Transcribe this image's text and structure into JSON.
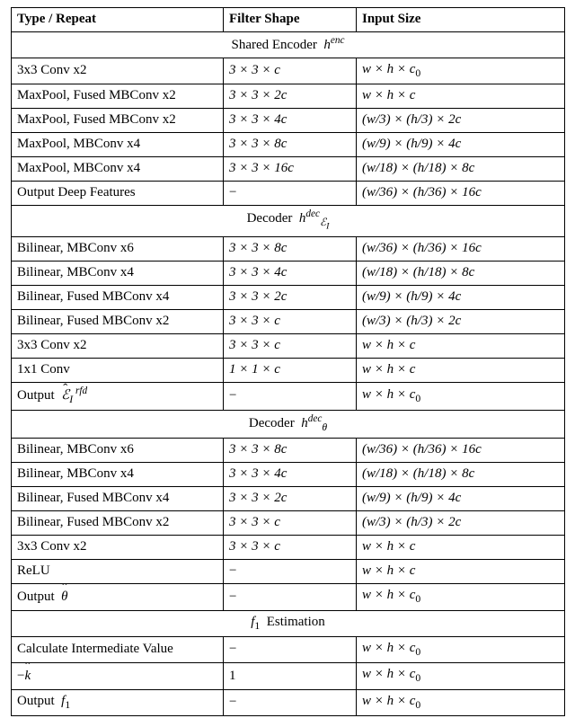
{
  "header": {
    "c1": "Type / Repeat",
    "c2": "Filter Shape",
    "c3": "Input Size"
  },
  "enc": {
    "title_pre": "Shared Encoder  ",
    "sym_h": "h",
    "sym_sup": "enc",
    "rows": [
      {
        "t": "3x3 Conv x2",
        "f": "3 × 3 × c",
        "i_pre": "w × h × c",
        "i_sub": "0"
      },
      {
        "t": "MaxPool, Fused MBConv x2",
        "f": "3 × 3 × 2c",
        "i_pre": "w × h × c",
        "i_sub": ""
      },
      {
        "t": "MaxPool, Fused MBConv x2",
        "f": "3 × 3 × 4c",
        "i_pre": "(w/3) × (h/3) × 2c",
        "i_sub": ""
      },
      {
        "t": "MaxPool, MBConv x4",
        "f": "3 × 3 × 8c",
        "i_pre": "(w/9) × (h/9) × 4c",
        "i_sub": ""
      },
      {
        "t": "MaxPool, MBConv x4",
        "f": "3 × 3 × 16c",
        "i_pre": "(w/18) × (h/18) × 8c",
        "i_sub": ""
      },
      {
        "t": "Output Deep Features",
        "f": "−",
        "i_pre": "(w/36) × (h/36) × 16c",
        "i_sub": ""
      }
    ]
  },
  "decE": {
    "title_pre": "Decoder  ",
    "sym_h": "h",
    "sym_sup": "dec",
    "sym_sub": "ℰ",
    "sym_subsub": "I",
    "rows": [
      {
        "t": "Bilinear, MBConv x6",
        "f": "3 × 3 × 8c",
        "i_pre": "(w/36) × (h/36) × 16c",
        "i_sub": ""
      },
      {
        "t": "Bilinear, MBConv x4",
        "f": "3 × 3 × 4c",
        "i_pre": "(w/18) × (h/18) × 8c",
        "i_sub": ""
      },
      {
        "t": "Bilinear, Fused MBConv x4",
        "f": "3 × 3 × 2c",
        "i_pre": "(w/9) × (h/9) × 4c",
        "i_sub": ""
      },
      {
        "t": "Bilinear, Fused MBConv x2",
        "f": "3 × 3 × c",
        "i_pre": "(w/3) × (h/3) × 2c",
        "i_sub": ""
      },
      {
        "t": "3x3 Conv x2",
        "f": "3 × 3 × c",
        "i_pre": "w × h × c",
        "i_sub": ""
      },
      {
        "t": "1x1 Conv",
        "f": "1 × 1 × c",
        "i_pre": "w × h × c",
        "i_sub": ""
      }
    ],
    "out": {
      "t_pre": "Output  ",
      "sym_E": "ℰ",
      "sym_Esub": "I",
      "sym_Esup": "rfd",
      "f": "−",
      "i_pre": "w × h × c",
      "i_sub": "0"
    }
  },
  "decT": {
    "title_pre": "Decoder  ",
    "sym_h": "h",
    "sym_sup": "dec",
    "sym_sub": "θ",
    "rows": [
      {
        "t": "Bilinear, MBConv x6",
        "f": "3 × 3 × 8c",
        "i_pre": "(w/36) × (h/36) × 16c",
        "i_sub": ""
      },
      {
        "t": "Bilinear, MBConv x4",
        "f": "3 × 3 × 4c",
        "i_pre": "(w/18) × (h/18) × 8c",
        "i_sub": ""
      },
      {
        "t": "Bilinear, Fused MBConv x4",
        "f": "3 × 3 × 2c",
        "i_pre": "(w/9) × (h/9) × 4c",
        "i_sub": ""
      },
      {
        "t": "Bilinear, Fused MBConv x2",
        "f": "3 × 3 × c",
        "i_pre": "(w/3) × (h/3) × 2c",
        "i_sub": ""
      },
      {
        "t": "3x3 Conv x2",
        "f": "3 × 3 × c",
        "i_pre": "w × h × c",
        "i_sub": ""
      },
      {
        "t": "ReLU",
        "f": "−",
        "i_pre": "w × h × c",
        "i_sub": ""
      }
    ],
    "out": {
      "t_pre": "Output  ",
      "sym_theta": "θ",
      "f": "−",
      "i_pre": "w × h × c",
      "i_sub": "0"
    }
  },
  "f1": {
    "title_f": "f",
    "title_sub": "1",
    "title_post": "  Estimation",
    "rows": [
      {
        "t": "Calculate Intermediate Value",
        "f": "−",
        "i_pre": "w × h × c",
        "i_sub": "0"
      }
    ],
    "neg": {
      "t_pre": "−",
      "sym_k": "k",
      "f": "1",
      "i_pre": "w × h × c",
      "i_sub": "0"
    },
    "out": {
      "t_pre": "Output  ",
      "sym_f": "f",
      "sym_sub": "1",
      "f": "−",
      "i_pre": "w × h × c",
      "i_sub": "0"
    }
  },
  "chart_data": {
    "type": "table",
    "title": "Network architecture",
    "columns": [
      "Type / Repeat",
      "Filter Shape",
      "Input Size"
    ],
    "sections": [
      {
        "heading": "Shared Encoder h^{enc}",
        "rows": [
          [
            "3x3 Conv x2",
            "3×3×c",
            "w×h×c_0"
          ],
          [
            "MaxPool, Fused MBConv x2",
            "3×3×2c",
            "w×h×c"
          ],
          [
            "MaxPool, Fused MBConv x2",
            "3×3×4c",
            "(w/3)×(h/3)×2c"
          ],
          [
            "MaxPool, MBConv x4",
            "3×3×8c",
            "(w/9)×(h/9)×4c"
          ],
          [
            "MaxPool, MBConv x4",
            "3×3×16c",
            "(w/18)×(h/18)×8c"
          ],
          [
            "Output Deep Features",
            "−",
            "(w/36)×(h/36)×16c"
          ]
        ]
      },
      {
        "heading": "Decoder h^{dec}_{E_I}",
        "rows": [
          [
            "Bilinear, MBConv x6",
            "3×3×8c",
            "(w/36)×(h/36)×16c"
          ],
          [
            "Bilinear, MBConv x4",
            "3×3×4c",
            "(w/18)×(h/18)×8c"
          ],
          [
            "Bilinear, Fused MBConv x4",
            "3×3×2c",
            "(w/9)×(h/9)×4c"
          ],
          [
            "Bilinear, Fused MBConv x2",
            "3×3×c",
            "(w/3)×(h/3)×2c"
          ],
          [
            "3x3 Conv x2",
            "3×3×c",
            "w×h×c"
          ],
          [
            "1x1 Conv",
            "1×1×c",
            "w×h×c"
          ],
          [
            "Output \\hat{E}_I^{rfd}",
            "−",
            "w×h×c_0"
          ]
        ]
      },
      {
        "heading": "Decoder h^{dec}_{θ}",
        "rows": [
          [
            "Bilinear, MBConv x6",
            "3×3×8c",
            "(w/36)×(h/36)×16c"
          ],
          [
            "Bilinear, MBConv x4",
            "3×3×4c",
            "(w/18)×(h/18)×8c"
          ],
          [
            "Bilinear, Fused MBConv x4",
            "3×3×2c",
            "(w/9)×(h/9)×4c"
          ],
          [
            "Bilinear, Fused MBConv x2",
            "3×3×c",
            "(w/3)×(h/3)×2c"
          ],
          [
            "3x3 Conv x2",
            "3×3×c",
            "w×h×c"
          ],
          [
            "ReLU",
            "−",
            "w×h×c"
          ],
          [
            "Output \\hat{θ}",
            "−",
            "w×h×c_0"
          ]
        ]
      },
      {
        "heading": "f_1 Estimation",
        "rows": [
          [
            "Calculate Intermediate Value",
            "−",
            "w×h×c_0"
          ],
          [
            "−\\hat{k}",
            "1",
            "w×h×c_0"
          ],
          [
            "Output f_1",
            "−",
            "w×h×c_0"
          ]
        ]
      }
    ]
  }
}
